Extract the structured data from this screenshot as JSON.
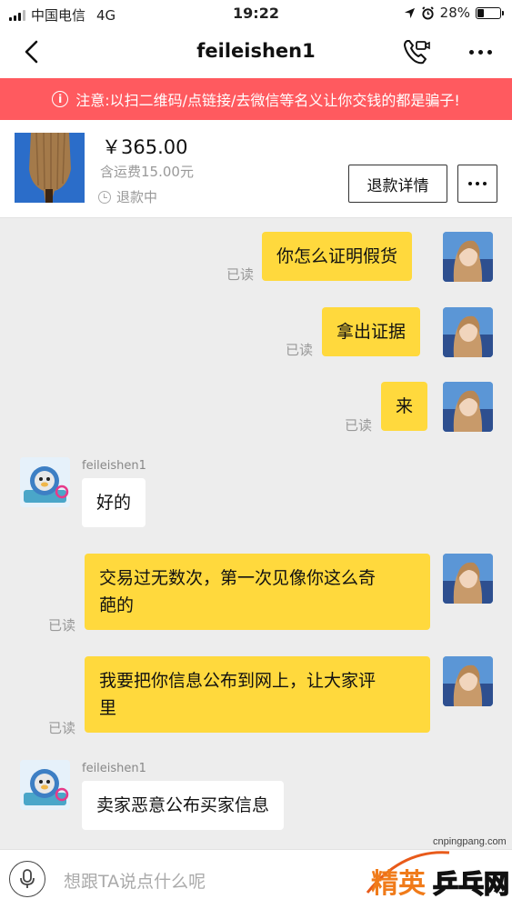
{
  "status_bar": {
    "carrier": "中国电信",
    "network": "4G",
    "time": "19:22",
    "battery": "28%",
    "battery_level": 0.28
  },
  "nav": {
    "title": "feileishen1"
  },
  "warning": {
    "icon": "info-circle-icon",
    "text": "注意:以扫二维码/点链接/去微信等名义让你交钱的都是骗子!"
  },
  "product": {
    "price": "￥365.00",
    "shipping": "含运费15.00元",
    "status": "退款中",
    "refund_button": "退款详情"
  },
  "messages": [
    {
      "from": "me",
      "text": "你怎么证明假货",
      "read": "已读"
    },
    {
      "from": "me",
      "text": "拿出证据",
      "read": "已读"
    },
    {
      "from": "me",
      "text": "来",
      "read": "已读"
    },
    {
      "from": "them",
      "sender": "feileishen1",
      "text": "好的"
    },
    {
      "from": "me",
      "lines": [
        "交易过无数次，第一次见像你这么奇",
        "葩的"
      ],
      "read": "已读"
    },
    {
      "from": "me",
      "lines": [
        "我要把你信息公布到网上，让大家评",
        "里"
      ],
      "read": "已读"
    },
    {
      "from": "them",
      "sender": "feileishen1",
      "text": "卖家恶意公布买家信息"
    }
  ],
  "input": {
    "placeholder": "想跟TA说点什么呢"
  },
  "watermark": {
    "url": "cnpingpang.com",
    "brand_left": "精英",
    "brand_right": "乒乓网"
  },
  "colors": {
    "warning_bg": "#ff5a5f",
    "my_bubble": "#ffd93d",
    "their_bubble": "#ffffff",
    "chat_bg": "#ededed"
  }
}
